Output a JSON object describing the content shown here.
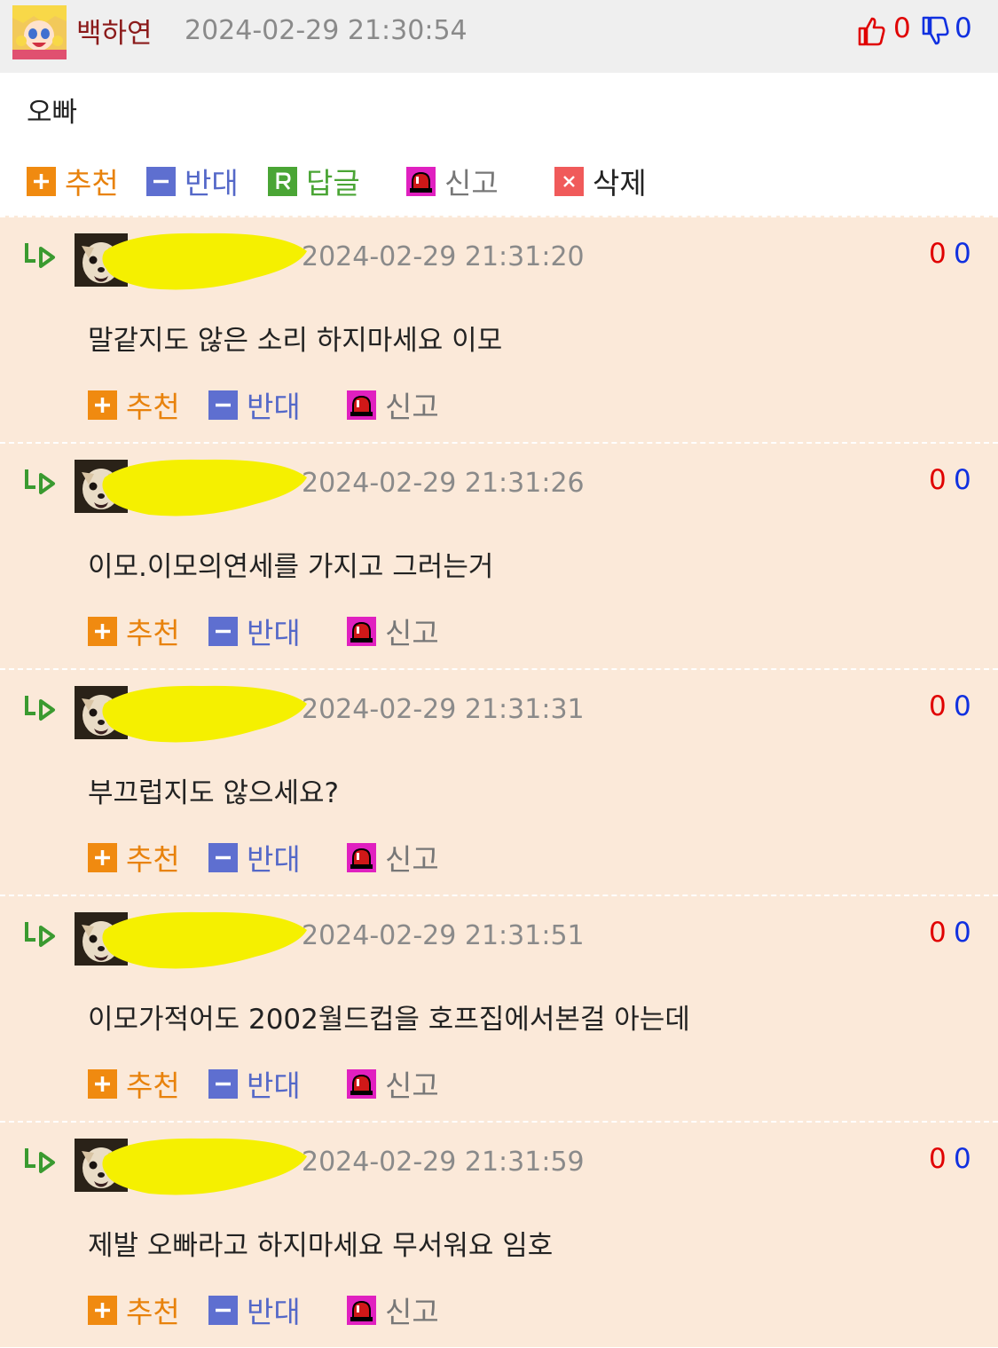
{
  "main": {
    "author": "백하연",
    "datetime": "2024-02-29 21:30:54",
    "likes": "0",
    "dislikes": "0",
    "body": "오빠",
    "actions": {
      "recommend": "추천",
      "oppose": "반대",
      "reply": "답글",
      "report": "신고",
      "delete": "삭제"
    }
  },
  "replies": [
    {
      "datetime": "2024-02-29 21:31:20",
      "likes": "0",
      "dislikes": "0",
      "body": "말같지도 않은 소리 하지마세요 이모",
      "recommend": "추천",
      "oppose": "반대",
      "report": "신고"
    },
    {
      "datetime": "2024-02-29 21:31:26",
      "likes": "0",
      "dislikes": "0",
      "body": "이모.이모의연세를 가지고 그러는거",
      "recommend": "추천",
      "oppose": "반대",
      "report": "신고"
    },
    {
      "datetime": "2024-02-29 21:31:31",
      "likes": "0",
      "dislikes": "0",
      "body": "부끄럽지도 않으세요?",
      "recommend": "추천",
      "oppose": "반대",
      "report": "신고"
    },
    {
      "datetime": "2024-02-29 21:31:51",
      "likes": "0",
      "dislikes": "0",
      "body": "이모가적어도 2002월드컵을 호프집에서본걸 아는데",
      "recommend": "추천",
      "oppose": "반대",
      "report": "신고"
    },
    {
      "datetime": "2024-02-29 21:31:59",
      "likes": "0",
      "dislikes": "0",
      "body": "제발 오빠라고 하지마세요 무서워요 임호",
      "recommend": "추천",
      "oppose": "반대",
      "report": "신고"
    }
  ],
  "colors": {
    "recommend": "#e8820c",
    "oppose": "#5468c8",
    "reply": "#4aa535",
    "report": "#777777",
    "delete": "#222222",
    "likes": "#e00000",
    "dislikes": "#1030e0",
    "reply_bg": "#fbe9d9"
  }
}
